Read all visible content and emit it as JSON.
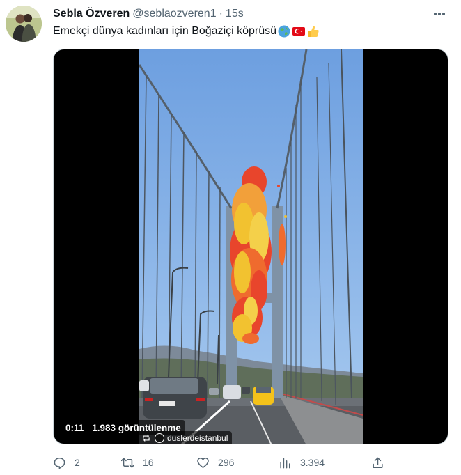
{
  "author": {
    "display_name": "Sebla Özveren",
    "handle": "@seblaozveren1",
    "separator": "·",
    "timestamp": "15s"
  },
  "tweet": {
    "text": "Emekçi dünya kadınları için Boğaziçi köprüsü",
    "emojis": [
      "globe-emoji",
      "turkey-flag-emoji",
      "thumbs-up-emoji"
    ]
  },
  "media": {
    "video_time": "0:11",
    "view_count": "1.983 görüntülenme",
    "credit": "duslerdeistanbul"
  },
  "actions": {
    "replies": "2",
    "reposts": "16",
    "likes": "296",
    "views": "3.394"
  },
  "colors": {
    "text_primary": "#0f1419",
    "text_secondary": "#536471",
    "sky": "#7fb0e8",
    "balloon_red": "#e8452c",
    "balloon_yellow": "#f2c230",
    "taxi": "#f4c21a"
  }
}
